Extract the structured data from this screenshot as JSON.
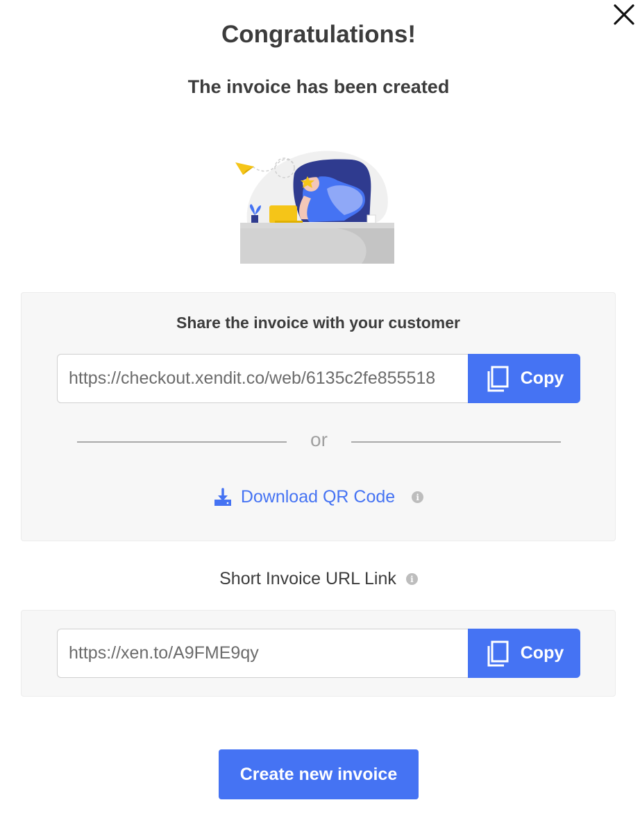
{
  "modal": {
    "title": "Congratulations!",
    "subtitle": "The invoice has been created"
  },
  "share": {
    "heading": "Share the invoice with your customer",
    "invoice_url": "https://checkout.xendit.co/web/6135c2fe855518",
    "copy_label": "Copy",
    "divider_label": "or",
    "download_label": "Download QR Code",
    "download_icon": "download-icon",
    "info_icon": "info-icon"
  },
  "short_link": {
    "label": "Short Invoice URL Link",
    "url": "https://xen.to/A9FME9qy",
    "copy_label": "Copy"
  },
  "actions": {
    "create_label": "Create new invoice"
  },
  "colors": {
    "accent": "#4573f3",
    "panel_bg": "#f7f7f7",
    "text": "#3c3c3c",
    "muted": "#a0a0a0"
  }
}
